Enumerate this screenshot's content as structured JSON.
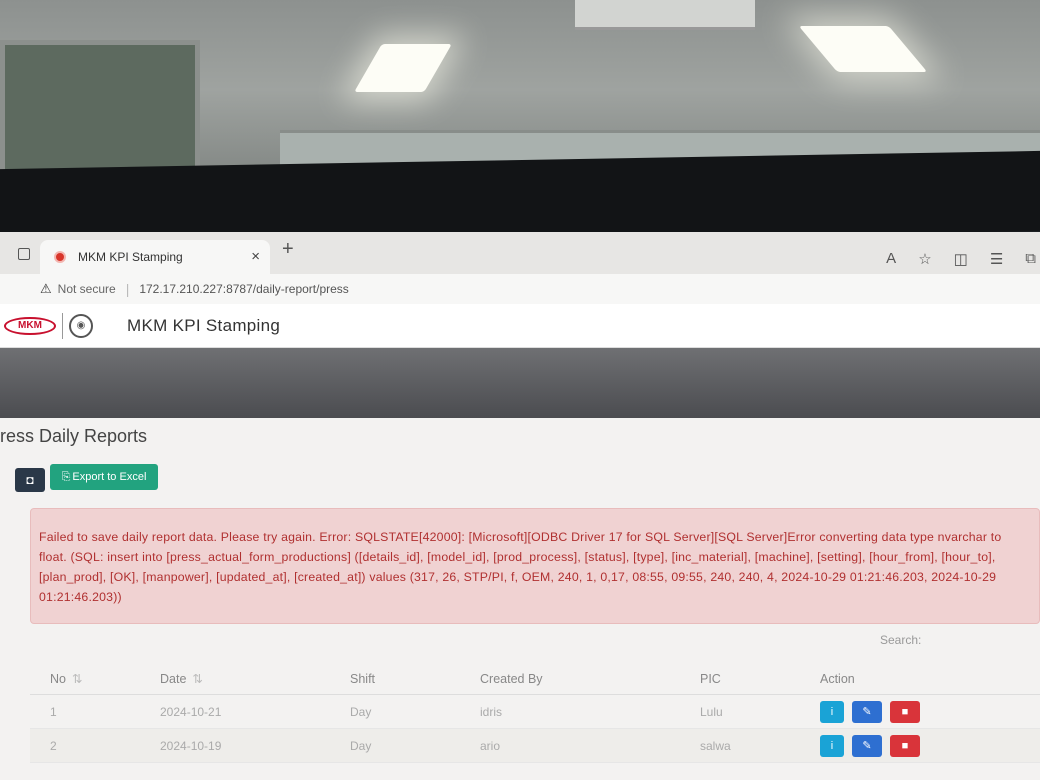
{
  "browser": {
    "tab_title": "MKM KPI Stamping",
    "tab_close": "×",
    "new_tab": "+",
    "not_secure": "Not secure",
    "url": "172.17.210.227:8787/daily-report/press",
    "icons": [
      "read-aloud-icon",
      "favorite-star-icon",
      "split-screen-icon",
      "favorites-list-icon",
      "collections-icon"
    ]
  },
  "app": {
    "logo_text": "MKM",
    "title": "MKM KPI Stamping"
  },
  "page": {
    "title": "ress Daily Reports",
    "add_button": "◘",
    "export_button": "Export to Excel",
    "export_icon": "⎘"
  },
  "alert": {
    "message": "Failed to save daily report data. Please try again. Error: SQLSTATE[42000]: [Microsoft][ODBC Driver 17 for SQL Server][SQL Server]Error converting data type nvarchar to float. (SQL: insert into [press_actual_form_productions] ([details_id], [model_id], [prod_process], [status], [type], [inc_material], [machine], [setting], [hour_from], [hour_to], [plan_prod], [OK], [manpower], [updated_at], [created_at]) values (317, 26, STP/PI, f, OEM, 240, 1, 0,17, 08:55, 09:55, 240, 240, 4, 2024-10-29 01:21:46.203, 2024-10-29 01:21:46.203))"
  },
  "search": {
    "label": "Search:"
  },
  "table": {
    "headers": {
      "no": "No",
      "date": "Date",
      "shift": "Shift",
      "created_by": "Created By",
      "pic": "PIC",
      "action": "Action"
    },
    "rows": [
      {
        "no": "1",
        "date": "2024-10-21",
        "shift": "Day",
        "created_by": "idris",
        "pic": "Lulu"
      },
      {
        "no": "2",
        "date": "2024-10-19",
        "shift": "Day",
        "created_by": "ario",
        "pic": "salwa"
      }
    ],
    "action_icons": {
      "info": "i",
      "edit": "✎",
      "delete": "■"
    }
  }
}
